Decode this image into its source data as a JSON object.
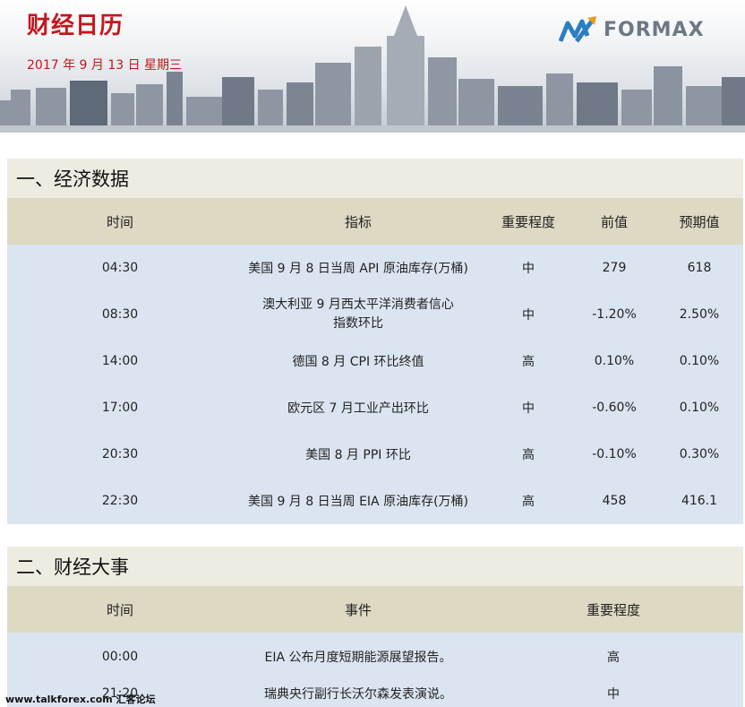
{
  "header": {
    "title": "财经日历",
    "date": "2017 年 9 月 13 日 星期三",
    "logo_text": "FORMAX",
    "logo_icon": "formax-logo-icon"
  },
  "economic_data": {
    "heading": "一、经济数据",
    "columns": [
      "时间",
      "指标",
      "重要程度",
      "前值",
      "预期值"
    ],
    "rows": [
      {
        "time": "04:30",
        "indicator": "美国 9 月 8 日当周 API 原油库存(万桶)",
        "importance": "中",
        "previous": "279",
        "forecast": "618"
      },
      {
        "time": "08:30",
        "indicator": "澳大利亚 9 月西太平洋消费者信心指数环比",
        "importance": "中",
        "previous": "-1.20%",
        "forecast": "2.50%"
      },
      {
        "time": "14:00",
        "indicator": "德国 8 月 CPI 环比终值",
        "importance": "高",
        "previous": "0.10%",
        "forecast": "0.10%"
      },
      {
        "time": "17:00",
        "indicator": "欧元区 7 月工业产出环比",
        "importance": "中",
        "previous": "-0.60%",
        "forecast": "0.10%"
      },
      {
        "time": "20:30",
        "indicator": "美国 8 月 PPI 环比",
        "importance": "高",
        "previous": "-0.10%",
        "forecast": "0.30%"
      },
      {
        "time": "22:30",
        "indicator": "美国 9 月 8 日当周 EIA 原油库存(万桶)",
        "importance": "高",
        "previous": "458",
        "forecast": "416.1"
      }
    ]
  },
  "events": {
    "heading": "二、财经大事",
    "columns": [
      "时间",
      "事件",
      "重要程度"
    ],
    "rows": [
      {
        "time": "00:00",
        "event": "EIA 公布月度短期能源展望报告。",
        "importance": "高"
      },
      {
        "time": "21:20",
        "event": "瑞典央行副行长沃尔森发表演说。",
        "importance": "中"
      }
    ]
  },
  "footer": {
    "watermark": "www.talkforex.com 汇客论坛"
  },
  "colors": {
    "title_red": "#c4161c",
    "section_bg": "#eeece1",
    "header_bg": "#ddd9c3",
    "body_bg": "#dbe5f1",
    "logo_blue": "#2a7fc1",
    "logo_orange": "#f39a1e"
  }
}
